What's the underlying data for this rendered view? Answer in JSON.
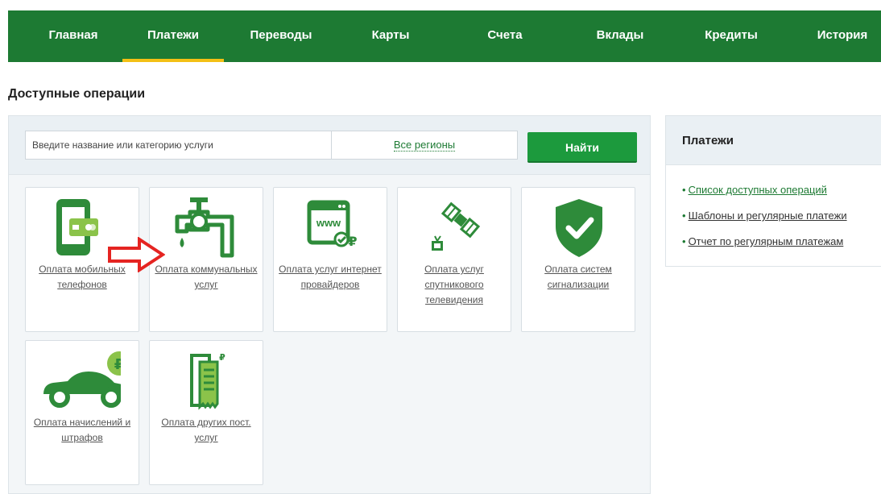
{
  "nav": {
    "items": [
      {
        "label": "Главная"
      },
      {
        "label": "Платежи",
        "active": true
      },
      {
        "label": "Переводы"
      },
      {
        "label": "Карты"
      },
      {
        "label": "Счета"
      },
      {
        "label": "Вклады"
      },
      {
        "label": "Кредиты"
      },
      {
        "label": "История"
      }
    ]
  },
  "page": {
    "title": "Доступные операции"
  },
  "search": {
    "placeholder": "Введите название или категорию услуги",
    "region": "Все регионы",
    "button": "Найти"
  },
  "tiles": [
    {
      "label": "Оплата мобильных телефонов",
      "icon": "mobile-payment-icon"
    },
    {
      "label": "Оплата коммунальных услуг",
      "icon": "utility-tap-icon"
    },
    {
      "label": "Оплата услуг интернет провайдеров",
      "icon": "www-internet-icon"
    },
    {
      "label": "Оплата услуг спутникового телевидения",
      "icon": "satellite-tv-icon"
    },
    {
      "label": "Оплата систем сигнализации",
      "icon": "shield-check-icon"
    },
    {
      "label": "Оплата начислений и штрафов",
      "icon": "car-fine-icon"
    },
    {
      "label": "Оплата других пост. услуг",
      "icon": "receipt-icon"
    }
  ],
  "side_panel": {
    "title": "Платежи",
    "links": [
      {
        "label": "Список доступных операций",
        "current": true
      },
      {
        "label": "Шаблоны и регулярные платежи"
      },
      {
        "label": "Отчет по регулярным платежам"
      }
    ]
  },
  "colors": {
    "brand_green": "#1d7a33",
    "button_green": "#1c9a3d",
    "active_tab_underline": "#f3c015",
    "icon_green": "#2e8b3a",
    "icon_light_green": "#8bc34a",
    "annotation_arrow": "#e52421"
  }
}
